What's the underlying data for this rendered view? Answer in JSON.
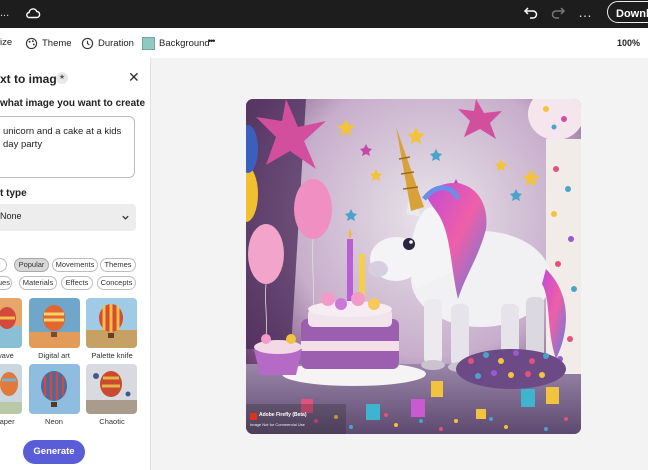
{
  "app": {
    "title_fragment": "...",
    "download_label": "Download",
    "more_dots": "…"
  },
  "toolbar": {
    "resize_label": "ize",
    "theme_label": "Theme",
    "duration_label": "Duration",
    "background_label": "Background",
    "background_color": "#8fc9c0",
    "more_label": "•••",
    "zoom": "100%"
  },
  "panel": {
    "title": "xt to image",
    "badge": "★",
    "close": "✕",
    "prompt_label": "what image you want to create",
    "prompt_value": "unicorn and a cake at a kids\nday party",
    "content_type_label": "t type",
    "content_type_value": "None",
    "chips": [
      {
        "label": "d",
        "active": false
      },
      {
        "label": "Popular",
        "active": true
      },
      {
        "label": "Movements",
        "active": false
      },
      {
        "label": "Themes",
        "active": false
      },
      {
        "label": "iques",
        "active": false
      },
      {
        "label": "Materials",
        "active": false
      },
      {
        "label": "Effects",
        "active": false
      },
      {
        "label": "Concepts",
        "active": false
      }
    ],
    "styles": [
      {
        "label": "wave"
      },
      {
        "label": "Digital art"
      },
      {
        "label": "Palette knife"
      },
      {
        "label": "paper"
      },
      {
        "label": "Neon"
      },
      {
        "label": "Chaotic"
      }
    ],
    "generate_label": "Generate"
  },
  "canvas": {
    "watermark_title": "Adobe Firefly (Beta)",
    "watermark_sub": "Image Not for Commercial Use"
  },
  "colors": {
    "accent": "#5a5dd8",
    "topbar": "#1d1d1d"
  }
}
